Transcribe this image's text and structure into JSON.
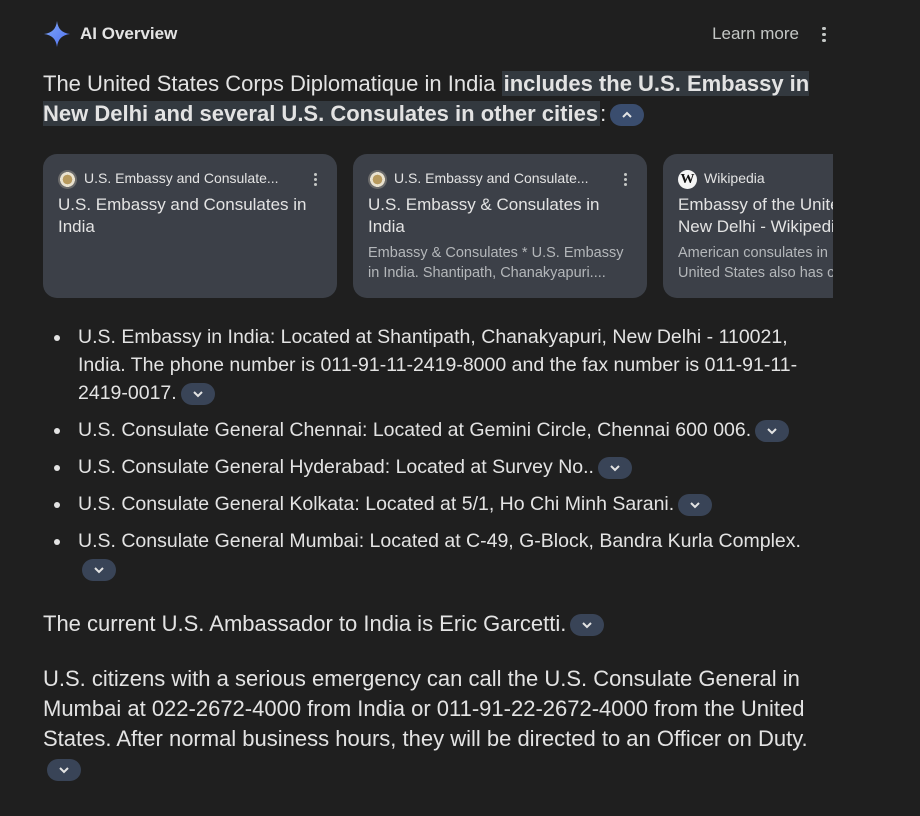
{
  "header": {
    "title": "AI Overview",
    "learn_more": "Learn more",
    "icon": "sparkle-icon"
  },
  "intro": {
    "text": "The United States Corps Diplomatique in India ",
    "highlight": "includes the U.S. Embassy in New Delhi and several U.S. Consulates in other cities",
    "suffix": ":"
  },
  "cards": [
    {
      "source": "U.S. Embassy and Consulate...",
      "title": "U.S. Embassy and Consulates in India",
      "snippet": ""
    },
    {
      "source": "U.S. Embassy and Consulate...",
      "title": "U.S. Embassy & Consulates in India",
      "snippet": "Embassy & Consulates * U.S. Embassy in India. Shantipath, Chanakyapuri...."
    },
    {
      "source": "Wikipedia",
      "title": "Embassy of the United States, New Delhi - Wikipedia",
      "snippet": "American consulates in India ... The United States also has consulates"
    }
  ],
  "bullets": [
    "U.S. Embassy in India: Located at Shantipath, Chanakyapuri, New Delhi - 110021, India. The phone number is 011-91-11-2419-8000 and the fax number is 011-91-11-2419-0017.",
    "U.S. Consulate General Chennai: Located at Gemini Circle, Chennai 600 006.",
    "U.S. Consulate General Hyderabad: Located at Survey No..",
    "U.S. Consulate General Kolkata: Located at 5/1, Ho Chi Minh Sarani.",
    "U.S. Consulate General Mumbai: Located at C-49, G-Block, Bandra Kurla Complex."
  ],
  "para1": "The current U.S. Ambassador to India is Eric Garcetti.",
  "para2": "U.S. citizens with a serious emergency can call the U.S. Consulate General in Mumbai at 022-2672-4000 from India or 011-91-22-2672-4000 from the United States. After normal business hours, they will be directed to an Officer on Duty.",
  "colors": {
    "background": "#1f1f1f",
    "card": "#3c4048",
    "chip": "#394457",
    "highlight": "#33393f",
    "sparkle_blue": "#4f8df5"
  }
}
